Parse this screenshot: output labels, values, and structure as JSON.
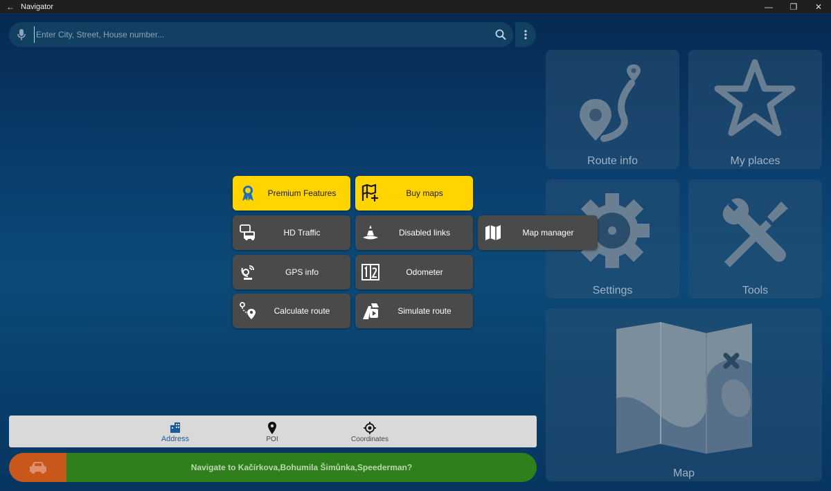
{
  "window": {
    "title": "Navigator",
    "back_glyph": "←",
    "minimize_glyph": "—",
    "maximize_glyph": "❐",
    "close_glyph": "✕"
  },
  "search": {
    "placeholder": "Enter City, Street, House number..."
  },
  "tiles": {
    "route_info": "Route info",
    "my_places": "My places",
    "settings": "Settings",
    "tools": "Tools",
    "map": "Map"
  },
  "popup": {
    "premium_features": "Premium Features",
    "buy_maps": "Buy maps",
    "hd_traffic": "HD Traffic",
    "disabled_links": "Disabled links",
    "map_manager": "Map manager",
    "gps_info": "GPS info",
    "odometer": "Odometer",
    "calculate_route": "Calculate route",
    "simulate_route": "Simulate route"
  },
  "tabs": {
    "address": "Address",
    "poi": "POI",
    "coordinates": "Coordinates"
  },
  "navigate": {
    "label": "Navigate to Kačírkova,Bohumila Šimůnka,Speederman?"
  },
  "colors": {
    "accent_yellow": "#ffd400",
    "go_green": "#2f7f1d",
    "car_orange": "#c8571c",
    "active_tab": "#1c5d99"
  }
}
